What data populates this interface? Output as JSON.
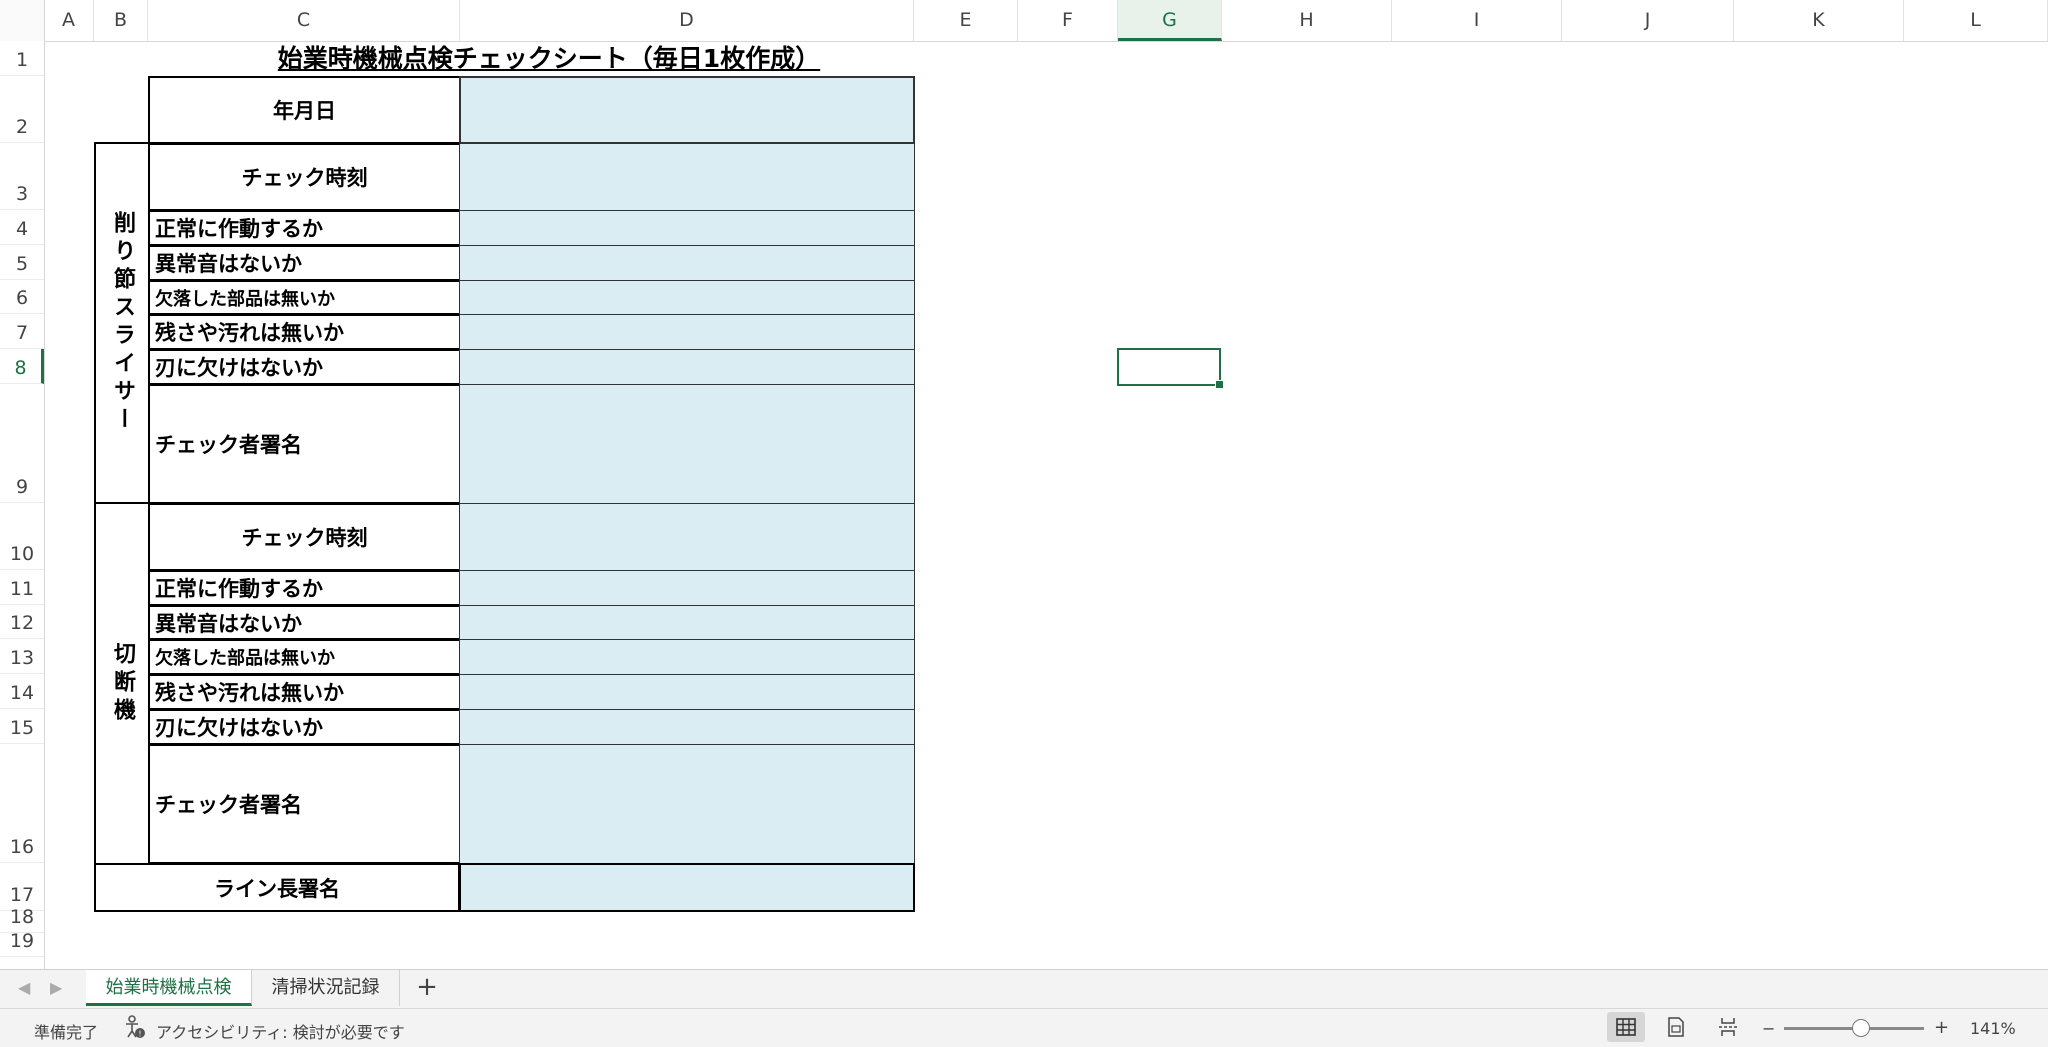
{
  "columns": [
    "A",
    "B",
    "C",
    "D",
    "E",
    "F",
    "G",
    "H",
    "I",
    "J",
    "K",
    "L"
  ],
  "selected_column": "G",
  "rows": [
    "1",
    "2",
    "3",
    "4",
    "5",
    "6",
    "7",
    "8",
    "9",
    "10",
    "11",
    "12",
    "13",
    "14",
    "15",
    "16",
    "17",
    "18",
    "19"
  ],
  "selected_row": "8",
  "sheet": {
    "title": "始業時機械点検チェックシート（毎日1枚作成）",
    "date_label": "年月日",
    "section1": {
      "name": "削り節スライサー",
      "check_time": "チェック時刻",
      "items": [
        "正常に作動するか",
        "異常音はないか",
        "欠落した部品は無いか",
        "残さや汚れは無いか",
        "刃に欠けはないか"
      ],
      "signature": "チェック者署名"
    },
    "section2": {
      "name": "切断機",
      "check_time": "チェック時刻",
      "items": [
        "正常に作動するか",
        "異常音はないか",
        "欠落した部品は無いか",
        "残さや汚れは無いか",
        "刃に欠けはないか"
      ],
      "signature": "チェック者署名"
    },
    "line_manager": "ライン長署名",
    "value_fill_color": "#daedf3"
  },
  "tabs": [
    {
      "label": "始業時機械点検",
      "active": true
    },
    {
      "label": "清掃状況記録",
      "active": false
    }
  ],
  "add_tab_symbol": "+",
  "status": {
    "ready": "準備完了",
    "accessibility": "アクセシビリティ: 検討が必要です",
    "zoom_minus": "−",
    "zoom_plus": "+",
    "zoom": "141%"
  },
  "accent_color": "#1e7145"
}
